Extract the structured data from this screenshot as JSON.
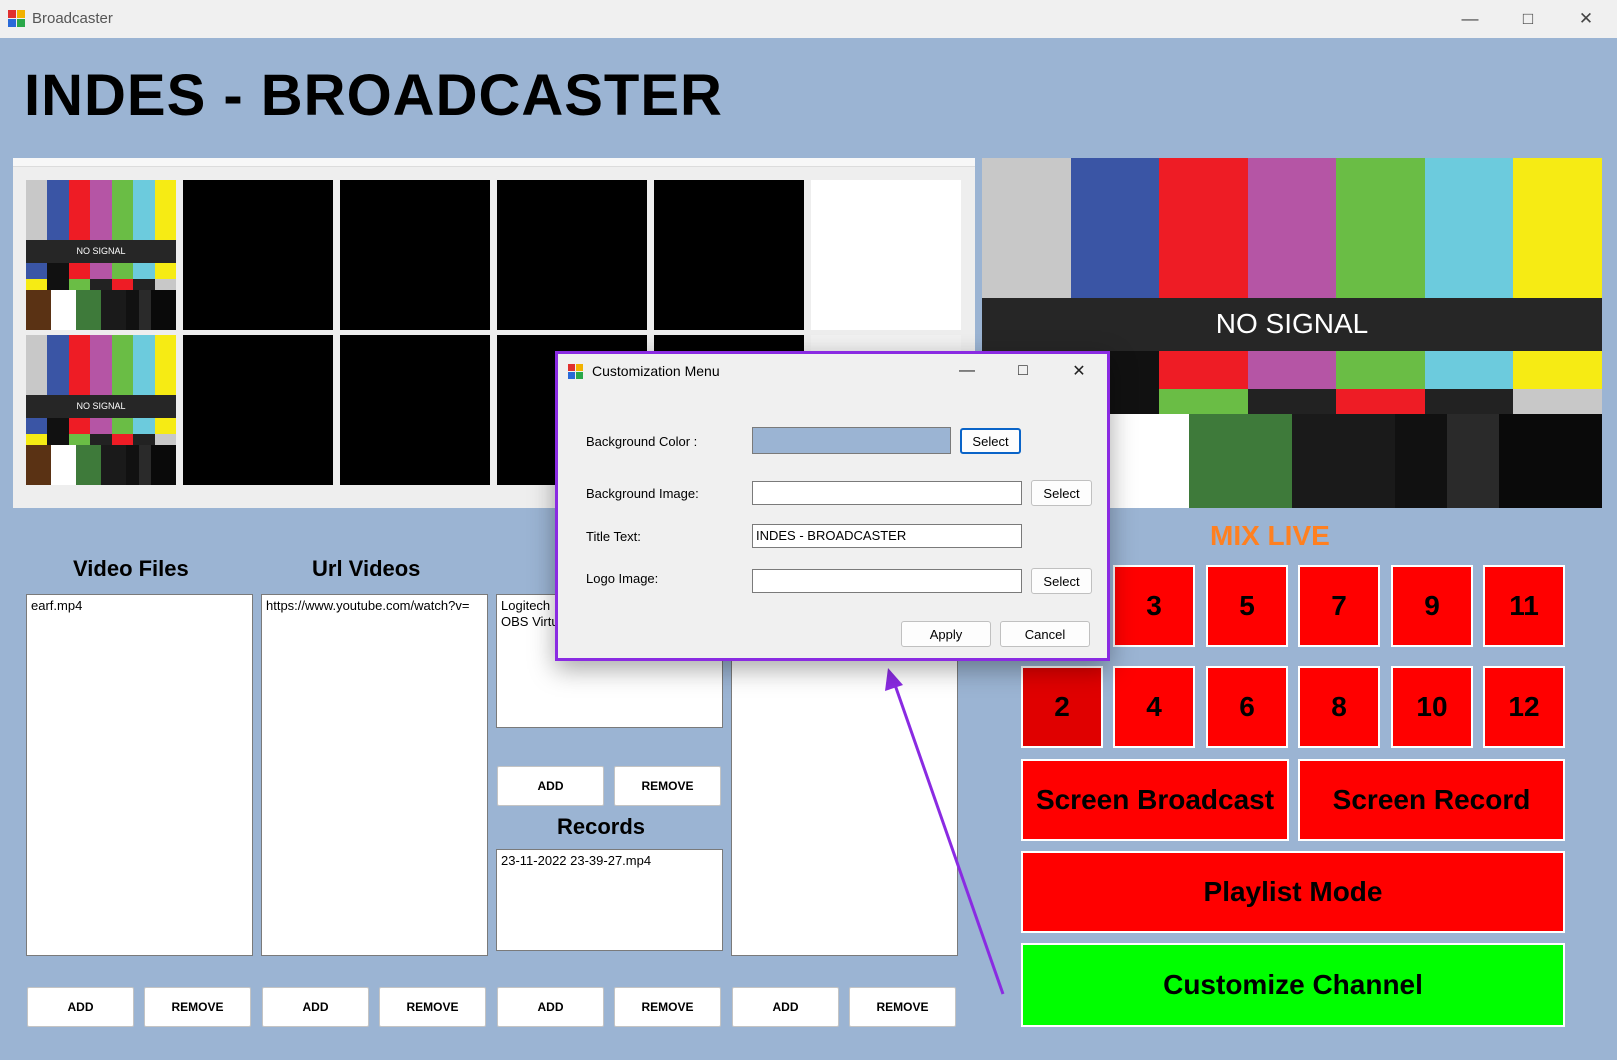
{
  "window": {
    "title": "Broadcaster",
    "minimize_icon": "minimize-icon",
    "maximize_icon": "maximize-icon",
    "close_icon": "close-icon"
  },
  "header": {
    "title": "INDES - BROADCASTER"
  },
  "preview": {
    "no_signal_small": "NO SIGNAL",
    "no_signal_big": "NO SIGNAL",
    "test_pattern_colors": [
      "#c8c8c8",
      "#3a55a5",
      "#ee1c25",
      "#b555a5",
      "#6abd45",
      "#6ccbdd",
      "#f6eb14"
    ]
  },
  "lists": {
    "video_files": {
      "title": "Video Files",
      "items": [
        "earf.mp4"
      ],
      "add": "ADD",
      "remove": "REMOVE"
    },
    "url_videos": {
      "title": "Url Videos",
      "items": [
        "https://www.youtube.com/watch?v="
      ],
      "add": "ADD",
      "remove": "REMOVE"
    },
    "cameras": {
      "items": [
        "Logitech",
        "OBS Virtu"
      ],
      "add": "ADD",
      "remove": "REMOVE",
      "add_bottom": "ADD",
      "remove_bottom": "REMOVE"
    },
    "records": {
      "title": "Records",
      "items": [
        "23-11-2022 23-39-27.mp4"
      ]
    },
    "fourth": {
      "add": "ADD",
      "remove": "REMOVE"
    }
  },
  "mix": {
    "title": "MIX LIVE",
    "channels": [
      "3",
      "5",
      "7",
      "9",
      "11",
      "2",
      "4",
      "6",
      "8",
      "10",
      "12"
    ],
    "screen_broadcast": "Screen Broadcast",
    "screen_record": "Screen Record",
    "playlist_mode": "Playlist Mode",
    "customize_channel": "Customize Channel"
  },
  "dialog": {
    "title": "Customization Menu",
    "background_color_label": "Background Color :",
    "background_color_value": "#9bb4d3",
    "background_image_label": "Background Image:",
    "background_image_value": "",
    "title_text_label": "Title Text:",
    "title_text_value": "INDES - BROADCASTER",
    "logo_image_label": "Logo Image:",
    "logo_image_value": "",
    "select": "Select",
    "apply": "Apply",
    "cancel": "Cancel"
  },
  "colors": {
    "app_background": "#9bb4d3",
    "mix_red": "#ff0000",
    "customize_green": "#00ff00",
    "mix_title": "#ff8020",
    "dialog_border": "#8a2be2",
    "arrow": "#8a2be2"
  }
}
